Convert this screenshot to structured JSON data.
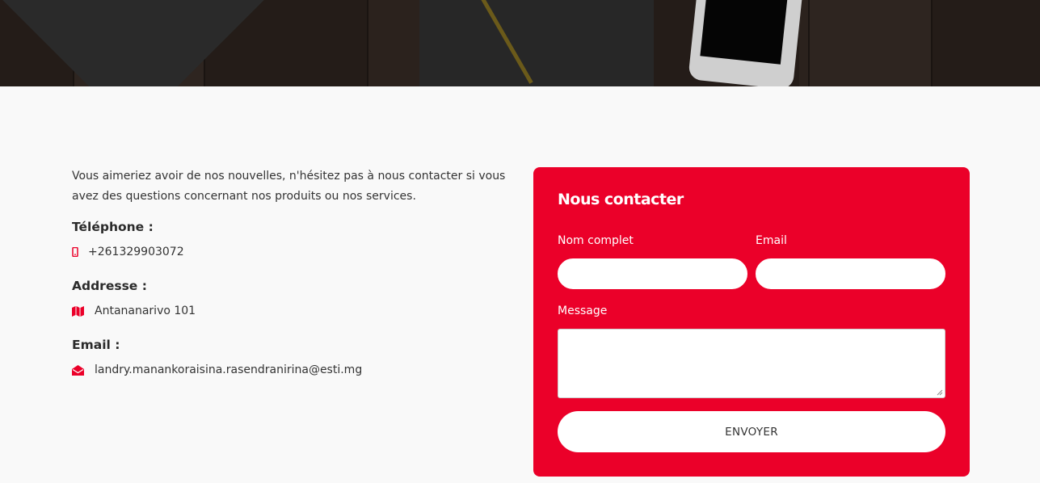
{
  "intro_text": "Vous aimeriez avoir de nos nouvelles, n'hésitez pas à nous contacter si vous avez des questions concernant nos produits ou nos services.",
  "contact_info": {
    "phone_label": "Téléphone :",
    "phone": "+261329903072",
    "address_label": "Addresse :",
    "address": "Antananarivo 101",
    "email_label": "Email :",
    "email": "landry.manankoraisina.rasendranirina@esti.mg"
  },
  "form": {
    "title": "Nous contacter",
    "name_label": "Nom complet",
    "email_label": "Email",
    "message_label": "Message",
    "name_value": "",
    "email_value": "",
    "message_value": "",
    "submit_label": "ENVOYER"
  },
  "colors": {
    "accent": "#eb0029",
    "background": "#f9f9f9"
  },
  "icons": {
    "phone": "mobile-phone-icon",
    "address": "map-icon",
    "email": "envelope-open-icon"
  }
}
